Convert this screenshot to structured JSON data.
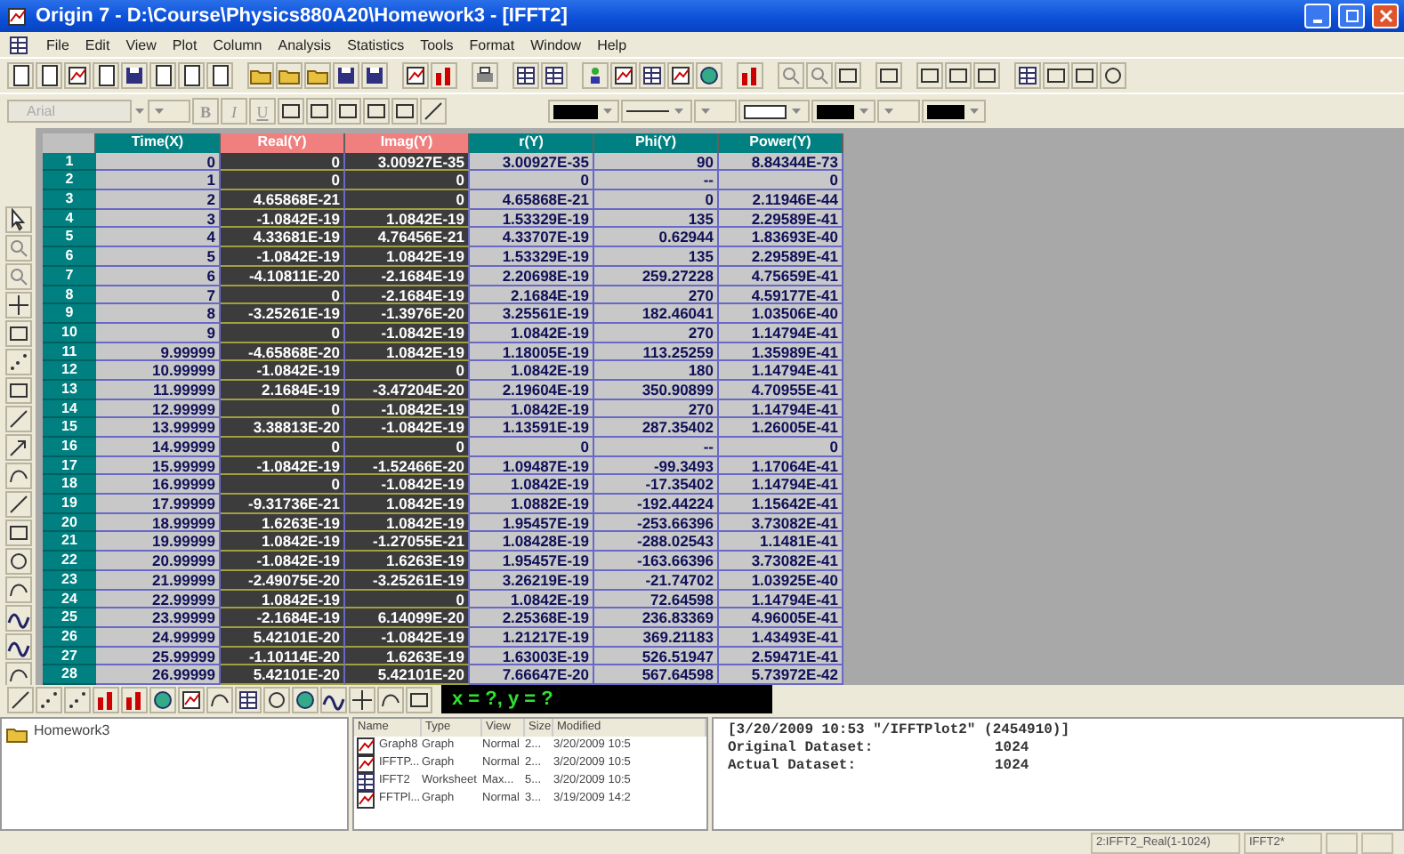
{
  "window": {
    "title": "Origin 7 - D:\\Course\\Physics880A20\\Homework3 - [IFFT2]"
  },
  "menu": [
    "File",
    "Edit",
    "View",
    "Plot",
    "Column",
    "Analysis",
    "Statistics",
    "Tools",
    "Format",
    "Window",
    "Help"
  ],
  "format_toolbar": {
    "font": "Arial",
    "buttons": [
      "B",
      "I",
      "U"
    ]
  },
  "worksheet": {
    "columns": [
      {
        "label": "Time(X)",
        "selected": false
      },
      {
        "label": "Real(Y)",
        "selected": true
      },
      {
        "label": "Imag(Y)",
        "selected": true
      },
      {
        "label": "r(Y)",
        "selected": false
      },
      {
        "label": "Phi(Y)",
        "selected": false
      },
      {
        "label": "Power(Y)",
        "selected": false
      }
    ],
    "rows": [
      {
        "n": "1",
        "cells": [
          "0",
          "0",
          "3.00927E-35",
          "3.00927E-35",
          "90",
          "8.84344E-73"
        ]
      },
      {
        "n": "2",
        "cells": [
          "1",
          "0",
          "0",
          "0",
          "--",
          "0"
        ]
      },
      {
        "n": "3",
        "cells": [
          "2",
          "4.65868E-21",
          "0",
          "4.65868E-21",
          "0",
          "2.11946E-44"
        ]
      },
      {
        "n": "4",
        "cells": [
          "3",
          "-1.0842E-19",
          "1.0842E-19",
          "1.53329E-19",
          "135",
          "2.29589E-41"
        ]
      },
      {
        "n": "5",
        "cells": [
          "4",
          "4.33681E-19",
          "4.76456E-21",
          "4.33707E-19",
          "0.62944",
          "1.83693E-40"
        ]
      },
      {
        "n": "6",
        "cells": [
          "5",
          "-1.0842E-19",
          "1.0842E-19",
          "1.53329E-19",
          "135",
          "2.29589E-41"
        ]
      },
      {
        "n": "7",
        "cells": [
          "6",
          "-4.10811E-20",
          "-2.1684E-19",
          "2.20698E-19",
          "259.27228",
          "4.75659E-41"
        ]
      },
      {
        "n": "8",
        "cells": [
          "7",
          "0",
          "-2.1684E-19",
          "2.1684E-19",
          "270",
          "4.59177E-41"
        ]
      },
      {
        "n": "9",
        "cells": [
          "8",
          "-3.25261E-19",
          "-1.3976E-20",
          "3.25561E-19",
          "182.46041",
          "1.03506E-40"
        ]
      },
      {
        "n": "10",
        "cells": [
          "9",
          "0",
          "-1.0842E-19",
          "1.0842E-19",
          "270",
          "1.14794E-41"
        ]
      },
      {
        "n": "11",
        "cells": [
          "9.99999",
          "-4.65868E-20",
          "1.0842E-19",
          "1.18005E-19",
          "113.25259",
          "1.35989E-41"
        ]
      },
      {
        "n": "12",
        "cells": [
          "10.99999",
          "-1.0842E-19",
          "0",
          "1.0842E-19",
          "180",
          "1.14794E-41"
        ]
      },
      {
        "n": "13",
        "cells": [
          "11.99999",
          "2.1684E-19",
          "-3.47204E-20",
          "2.19604E-19",
          "350.90899",
          "4.70955E-41"
        ]
      },
      {
        "n": "14",
        "cells": [
          "12.99999",
          "0",
          "-1.0842E-19",
          "1.0842E-19",
          "270",
          "1.14794E-41"
        ]
      },
      {
        "n": "15",
        "cells": [
          "13.99999",
          "3.38813E-20",
          "-1.0842E-19",
          "1.13591E-19",
          "287.35402",
          "1.26005E-41"
        ]
      },
      {
        "n": "16",
        "cells": [
          "14.99999",
          "0",
          "0",
          "0",
          "--",
          "0"
        ]
      },
      {
        "n": "17",
        "cells": [
          "15.99999",
          "-1.0842E-19",
          "-1.52466E-20",
          "1.09487E-19",
          "-99.3493",
          "1.17064E-41"
        ]
      },
      {
        "n": "18",
        "cells": [
          "16.99999",
          "0",
          "-1.0842E-19",
          "1.0842E-19",
          "-17.35402",
          "1.14794E-41"
        ]
      },
      {
        "n": "19",
        "cells": [
          "17.99999",
          "-9.31736E-21",
          "1.0842E-19",
          "1.0882E-19",
          "-192.44224",
          "1.15642E-41"
        ]
      },
      {
        "n": "20",
        "cells": [
          "18.99999",
          "1.6263E-19",
          "1.0842E-19",
          "1.95457E-19",
          "-253.66396",
          "3.73082E-41"
        ]
      },
      {
        "n": "21",
        "cells": [
          "19.99999",
          "1.0842E-19",
          "-1.27055E-21",
          "1.08428E-19",
          "-288.02543",
          "1.1481E-41"
        ]
      },
      {
        "n": "22",
        "cells": [
          "20.99999",
          "-1.0842E-19",
          "1.6263E-19",
          "1.95457E-19",
          "-163.66396",
          "3.73082E-41"
        ]
      },
      {
        "n": "23",
        "cells": [
          "21.99999",
          "-2.49075E-20",
          "-3.25261E-19",
          "3.26219E-19",
          "-21.74702",
          "1.03925E-40"
        ]
      },
      {
        "n": "24",
        "cells": [
          "22.99999",
          "1.0842E-19",
          "0",
          "1.0842E-19",
          "72.64598",
          "1.14794E-41"
        ]
      },
      {
        "n": "25",
        "cells": [
          "23.99999",
          "-2.1684E-19",
          "6.14099E-20",
          "2.25368E-19",
          "236.83369",
          "4.96005E-41"
        ]
      },
      {
        "n": "26",
        "cells": [
          "24.99999",
          "5.42101E-20",
          "-1.0842E-19",
          "1.21217E-19",
          "369.21183",
          "1.43493E-41"
        ]
      },
      {
        "n": "27",
        "cells": [
          "25.99999",
          "-1.10114E-20",
          "1.6263E-19",
          "1.63003E-19",
          "526.51947",
          "2.59471E-41"
        ]
      },
      {
        "n": "28",
        "cells": [
          "26.99999",
          "5.42101E-20",
          "5.42101E-20",
          "7.66647E-20",
          "567.64598",
          "5.73972E-42"
        ]
      }
    ]
  },
  "coordinates": "x = ?, y = ?",
  "project_explorer": {
    "folder": "Homework3",
    "columns": [
      "Name",
      "Type",
      "View",
      "Size",
      "Modified"
    ],
    "items": [
      {
        "kind": "graph",
        "cells": [
          "Graph8",
          "Graph",
          "Normal",
          "2...",
          "3/20/2009 10:5"
        ]
      },
      {
        "kind": "graph",
        "cells": [
          "IFFTP...",
          "Graph",
          "Normal",
          "2...",
          "3/20/2009 10:5"
        ]
      },
      {
        "kind": "worksheet",
        "cells": [
          "IFFT2",
          "Worksheet",
          "Max...",
          "5...",
          "3/20/2009 10:5"
        ]
      },
      {
        "kind": "graph",
        "cells": [
          "FFTPl...",
          "Graph",
          "Normal",
          "3...",
          "3/19/2009 14:2"
        ]
      }
    ]
  },
  "results_log": {
    "header": "[3/20/2009 10:53 \"/IFFTPlot2\" (2454910)]",
    "lines": [
      {
        "label": "Original Dataset:",
        "value": "1024"
      },
      {
        "label": "Actual Dataset:",
        "value": "1024"
      }
    ]
  },
  "status_bar": [
    "2:IFFT2_Real(1-1024)",
    "IFFT2*"
  ]
}
